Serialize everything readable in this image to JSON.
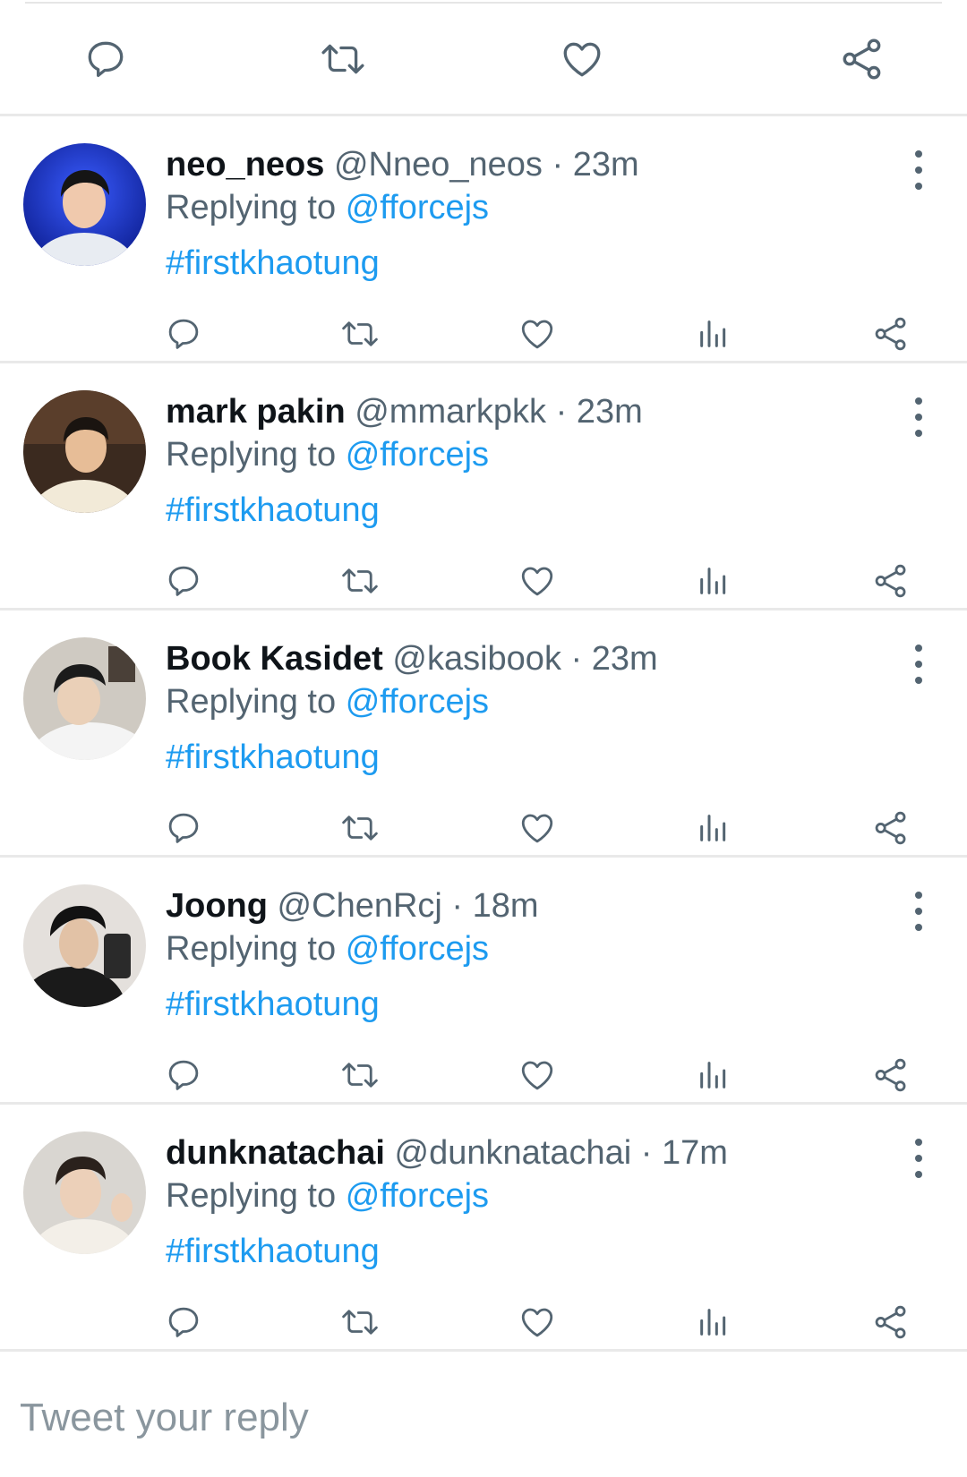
{
  "reply_box": {
    "placeholder": "Tweet your reply"
  },
  "colors": {
    "accent": "#1d9bf0",
    "text": "#0f1419",
    "muted": "#536471",
    "divider": "#e9e9e9"
  },
  "main_actions": [
    "reply-icon",
    "retweet-icon",
    "like-icon",
    "share-icon"
  ],
  "tweets": [
    {
      "name": "neo_neos",
      "handle": "@Nneo_neos",
      "time": "23m",
      "reply_prefix": "Replying to",
      "reply_to": "@fforcejs",
      "hashtag": "#firstkhaotung",
      "actions": [
        "reply-icon",
        "retweet-icon",
        "like-icon",
        "analytics-icon",
        "share-icon"
      ]
    },
    {
      "name": "mark pakin",
      "handle": "@mmarkpkk",
      "time": "23m",
      "reply_prefix": "Replying to",
      "reply_to": "@fforcejs",
      "hashtag": "#firstkhaotung",
      "actions": [
        "reply-icon",
        "retweet-icon",
        "like-icon",
        "analytics-icon",
        "share-icon"
      ]
    },
    {
      "name": "Book Kasidet",
      "handle": "@kasibook",
      "time": "23m",
      "reply_prefix": "Replying to",
      "reply_to": "@fforcejs",
      "hashtag": "#firstkhaotung",
      "actions": [
        "reply-icon",
        "retweet-icon",
        "like-icon",
        "analytics-icon",
        "share-icon"
      ]
    },
    {
      "name": "Joong",
      "handle": "@ChenRcj",
      "time": "18m",
      "reply_prefix": "Replying to",
      "reply_to": "@fforcejs",
      "hashtag": "#firstkhaotung",
      "actions": [
        "reply-icon",
        "retweet-icon",
        "like-icon",
        "analytics-icon",
        "share-icon"
      ]
    },
    {
      "name": "dunknatachai",
      "handle": "@dunknatachai",
      "time": "17m",
      "reply_prefix": "Replying to",
      "reply_to": "@fforcejs",
      "hashtag": "#firstkhaotung",
      "actions": [
        "reply-icon",
        "retweet-icon",
        "like-icon",
        "analytics-icon",
        "share-icon"
      ]
    }
  ]
}
